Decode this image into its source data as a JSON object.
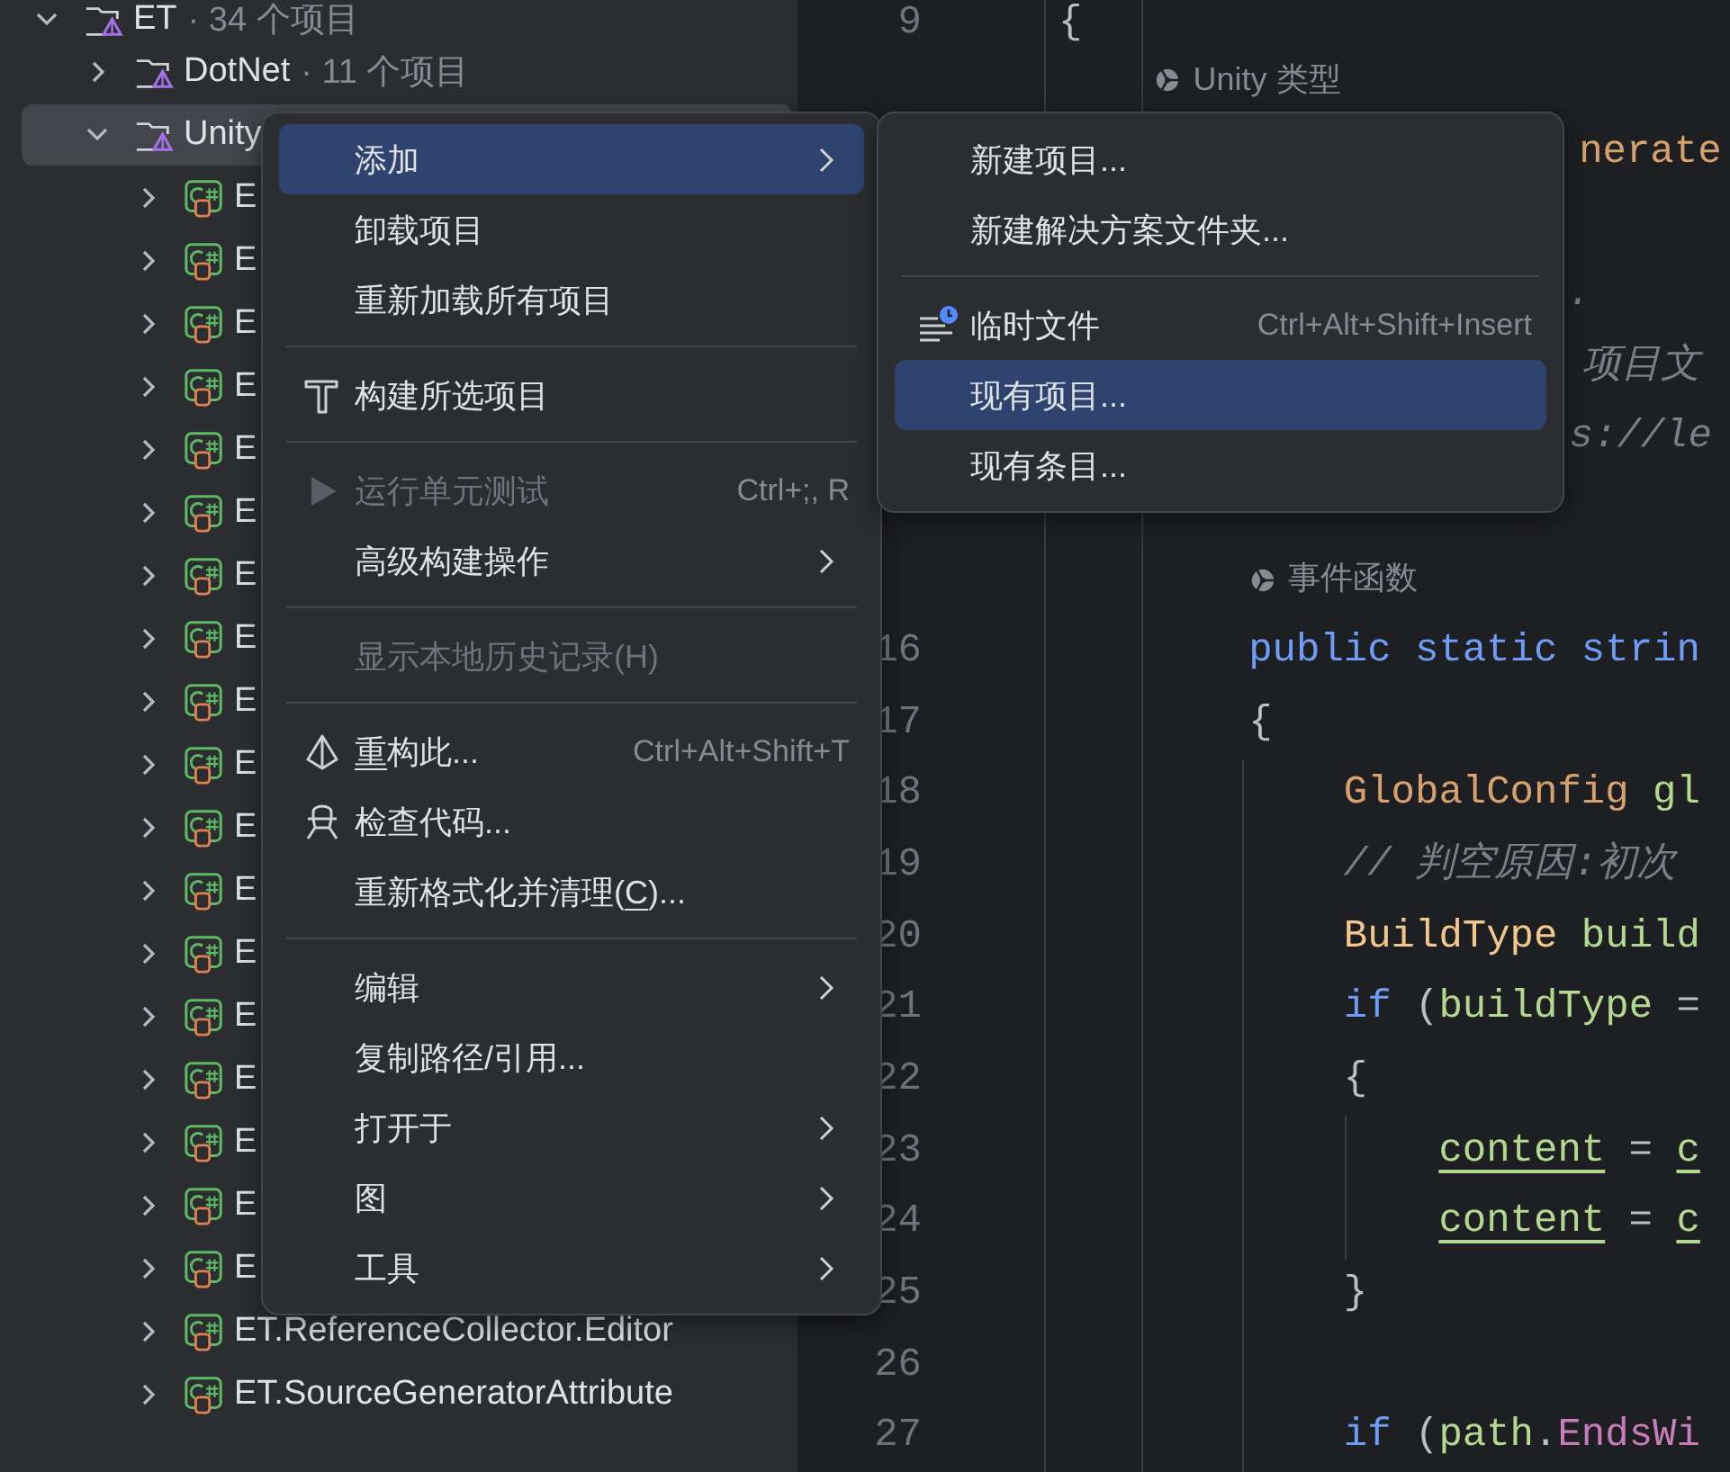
{
  "project_tree": {
    "items": [
      {
        "kind": "folder",
        "name": "ET",
        "count": "· 34 个项目",
        "expanded": true,
        "selected": false,
        "children": [
          {
            "kind": "folder",
            "name": "DotNet",
            "count": "· 11 个项目",
            "expanded": false,
            "selected": false
          },
          {
            "kind": "folder",
            "name": "Unity",
            "expanded": true,
            "selected": true,
            "children": [
              {
                "kind": "project",
                "name": "E",
                "expanded": false,
                "selected": false
              },
              {
                "kind": "project",
                "name": "E",
                "expanded": false,
                "selected": false
              },
              {
                "kind": "project",
                "name": "E",
                "expanded": false,
                "selected": false
              },
              {
                "kind": "project",
                "name": "E",
                "expanded": false,
                "selected": false
              },
              {
                "kind": "project",
                "name": "E",
                "expanded": false,
                "selected": false
              },
              {
                "kind": "project",
                "name": "E",
                "expanded": false,
                "selected": false
              },
              {
                "kind": "project",
                "name": "E",
                "expanded": false,
                "selected": false
              },
              {
                "kind": "project",
                "name": "E",
                "expanded": false,
                "selected": false
              },
              {
                "kind": "project",
                "name": "E",
                "expanded": false,
                "selected": false
              },
              {
                "kind": "project",
                "name": "E",
                "expanded": false,
                "selected": false
              },
              {
                "kind": "project",
                "name": "E",
                "expanded": false,
                "selected": false
              },
              {
                "kind": "project",
                "name": "E",
                "expanded": false,
                "selected": false
              },
              {
                "kind": "project",
                "name": "E",
                "expanded": false,
                "selected": false
              },
              {
                "kind": "project",
                "name": "E",
                "expanded": false,
                "selected": false
              },
              {
                "kind": "project",
                "name": "E",
                "expanded": false,
                "selected": false
              },
              {
                "kind": "project",
                "name": "E",
                "expanded": false,
                "selected": false
              },
              {
                "kind": "project",
                "name": "E",
                "expanded": false,
                "selected": false
              },
              {
                "kind": "project",
                "name": "E",
                "expanded": false,
                "selected": false
              },
              {
                "kind": "project",
                "name": "ET.ReferenceCollector.Editor",
                "expanded": false,
                "selected": false
              },
              {
                "kind": "project",
                "name": "ET.SourceGeneratorAttribute",
                "expanded": false,
                "selected": false
              }
            ]
          }
        ]
      }
    ]
  },
  "editor": {
    "lines": [
      {
        "kind": "code",
        "number": "9",
        "segments": [
          {
            "kind": "punct",
            "text": "{"
          }
        ]
      },
      {
        "kind": "hint",
        "text": "Unity 类型"
      },
      {
        "kind": "code",
        "segments": [
          {
            "kind": "type_class",
            "text": "nerate"
          }
        ]
      },
      {
        "kind": "code"
      },
      {
        "kind": "code",
        "segments": [
          {
            "kind": "comment",
            "text": "."
          }
        ]
      },
      {
        "kind": "code",
        "segments": [
          {
            "kind": "comment",
            "text": "项目文"
          }
        ]
      },
      {
        "kind": "code",
        "segments": [
          {
            "kind": "comment",
            "text": "s://le"
          }
        ]
      },
      {
        "kind": "code"
      },
      {
        "kind": "hint",
        "text": "事件函数"
      },
      {
        "kind": "code",
        "number": "16",
        "segments": [
          {
            "kind": "keyword",
            "text": "public static strin"
          }
        ]
      },
      {
        "kind": "code",
        "number": "17",
        "segments": [
          {
            "kind": "punct",
            "text": "{"
          }
        ]
      },
      {
        "kind": "code",
        "number": "18",
        "segments": [
          {
            "kind": "type_class",
            "text": "GlobalConfig"
          },
          {
            "kind": "local",
            "text": " gl"
          }
        ]
      },
      {
        "kind": "code",
        "number": "19",
        "segments": [
          {
            "kind": "comment",
            "text": "// 判空原因:初次"
          }
        ]
      },
      {
        "kind": "code",
        "number": "20",
        "segments": [
          {
            "kind": "type_struct",
            "text": "BuildType"
          },
          {
            "kind": "local",
            "text": " build"
          }
        ]
      },
      {
        "kind": "code",
        "number": "21",
        "segments": [
          {
            "kind": "keyword",
            "text": "if"
          },
          {
            "kind": "punct",
            "text": " ("
          },
          {
            "kind": "local",
            "text": "buildType"
          },
          {
            "kind": "punct",
            "text": " ="
          }
        ]
      },
      {
        "kind": "code",
        "number": "22",
        "segments": [
          {
            "kind": "punct",
            "text": "{"
          }
        ]
      },
      {
        "kind": "code",
        "number": "23",
        "segments": [
          {
            "kind": "captured",
            "text": "content"
          },
          {
            "kind": "punct",
            "text": " = "
          },
          {
            "kind": "captured",
            "text": "c"
          }
        ]
      },
      {
        "kind": "code",
        "number": "24",
        "segments": [
          {
            "kind": "captured",
            "text": "content"
          },
          {
            "kind": "punct",
            "text": " = "
          },
          {
            "kind": "captured",
            "text": "c"
          }
        ]
      },
      {
        "kind": "code",
        "number": "25",
        "segments": [
          {
            "kind": "punct",
            "text": "}"
          }
        ]
      },
      {
        "kind": "code",
        "number": "26"
      },
      {
        "kind": "code",
        "number": "27",
        "segments": [
          {
            "kind": "keyword",
            "text": "if"
          },
          {
            "kind": "punct",
            "text": " ("
          },
          {
            "kind": "local",
            "text": "path"
          },
          {
            "kind": "punct",
            "text": "."
          },
          {
            "kind": "method",
            "text": "EndsWi"
          }
        ]
      }
    ]
  },
  "context_menu": {
    "items": [
      {
        "kind": "item",
        "label": "添加",
        "selected": true,
        "disabled": false,
        "submenu": true
      },
      {
        "kind": "item",
        "label": "卸载项目",
        "selected": false,
        "disabled": false,
        "submenu": false
      },
      {
        "kind": "item",
        "label": "重新加载所有项目",
        "selected": false,
        "disabled": false,
        "submenu": false
      },
      {
        "kind": "separator"
      },
      {
        "kind": "item",
        "label": "构建所选项目",
        "selected": false,
        "disabled": false,
        "submenu": false
      },
      {
        "kind": "separator"
      },
      {
        "kind": "item",
        "label": "运行单元测试",
        "shortcut": "Ctrl+;, R",
        "selected": false,
        "disabled": true,
        "submenu": false
      },
      {
        "kind": "item",
        "label": "高级构建操作",
        "selected": false,
        "disabled": false,
        "submenu": true
      },
      {
        "kind": "separator"
      },
      {
        "kind": "item",
        "label": "显示本地历史记录(H)",
        "selected": false,
        "disabled": true,
        "submenu": false
      },
      {
        "kind": "separator"
      },
      {
        "kind": "item",
        "label_parts": [
          {
            "text": "重",
            "underline": true
          },
          {
            "text": "构此...",
            "underline": false
          }
        ],
        "shortcut": "Ctrl+Alt+Shift+T",
        "selected": false,
        "disabled": false,
        "submenu": false
      },
      {
        "kind": "item",
        "label": "检查代码...",
        "selected": false,
        "disabled": false,
        "submenu": false
      },
      {
        "kind": "item",
        "label_parts": [
          {
            "text": "重新格式化并清理(",
            "underline": false
          },
          {
            "text": "C",
            "underline": true
          },
          {
            "text": ")...",
            "underline": false
          }
        ],
        "selected": false,
        "disabled": false,
        "submenu": false
      },
      {
        "kind": "separator"
      },
      {
        "kind": "item",
        "label": "编辑",
        "selected": false,
        "disabled": false,
        "submenu": true
      },
      {
        "kind": "item",
        "label": "复制路径/引用...",
        "selected": false,
        "disabled": false,
        "submenu": false
      },
      {
        "kind": "item",
        "label": "打开于",
        "selected": false,
        "disabled": false,
        "submenu": true
      },
      {
        "kind": "item",
        "label": "图",
        "selected": false,
        "disabled": false,
        "submenu": true
      },
      {
        "kind": "item",
        "label": "工具",
        "selected": false,
        "disabled": false,
        "submenu": true
      }
    ]
  },
  "add_submenu": {
    "items": [
      {
        "kind": "item",
        "label": "新建项目...",
        "selected": false,
        "disabled": false,
        "submenu": false
      },
      {
        "kind": "item",
        "label": "新建解决方案文件夹...",
        "selected": false,
        "disabled": false,
        "submenu": false
      },
      {
        "kind": "separator"
      },
      {
        "kind": "item",
        "label": "临时文件",
        "shortcut": "Ctrl+Alt+Shift+Insert",
        "selected": false,
        "disabled": false,
        "submenu": false
      },
      {
        "kind": "item",
        "label": "现有项目...",
        "selected": true,
        "disabled": false,
        "submenu": false
      },
      {
        "kind": "item",
        "label": "现有条目...",
        "selected": false,
        "disabled": false,
        "submenu": false
      }
    ]
  }
}
